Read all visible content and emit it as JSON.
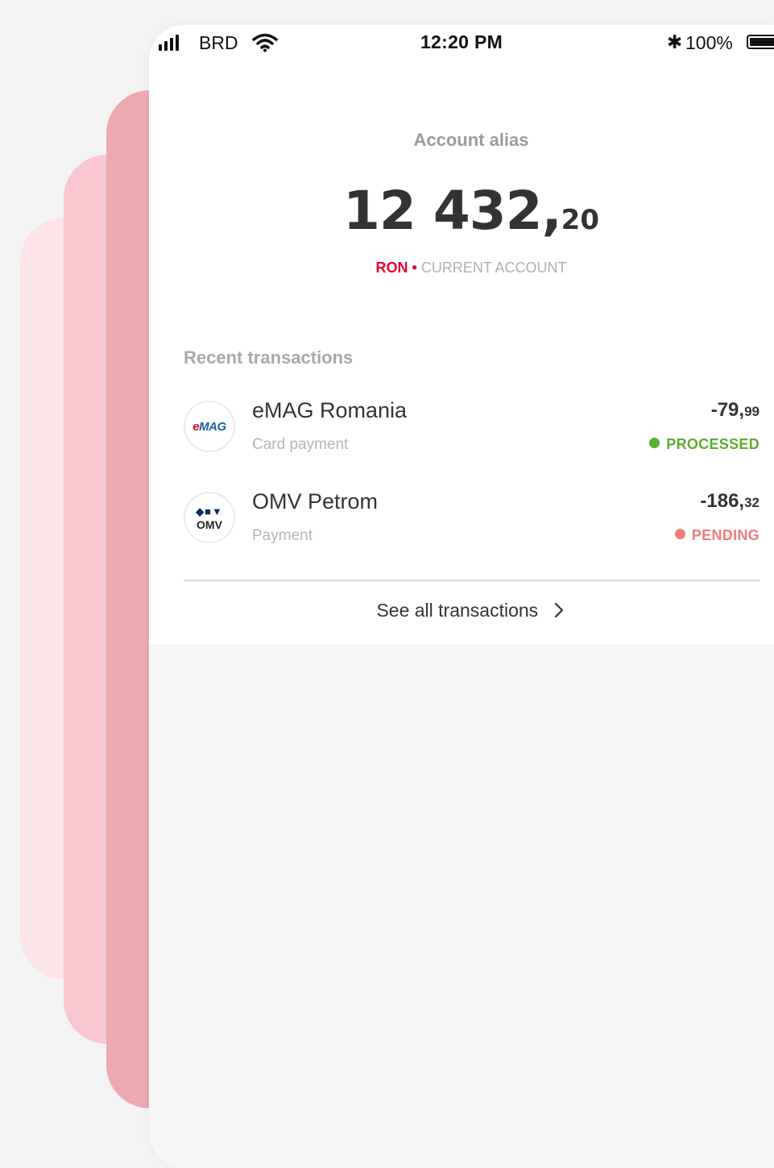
{
  "status_bar": {
    "carrier": "BRD",
    "time": "12:20 PM",
    "battery": "100%",
    "icons": [
      "signal-icon",
      "wifi-icon",
      "bluetooth-icon",
      "battery-icon"
    ]
  },
  "account": {
    "alias": "Account alias",
    "balance_int": "12 432,",
    "balance_dec": "20",
    "currency": "RON",
    "separator": "•",
    "type": "CURRENT ACCOUNT"
  },
  "transactions": {
    "title": "Recent transactions",
    "items": [
      {
        "merchant": "eMAG Romania",
        "type": "Card payment",
        "amount_int": "-79,",
        "amount_dec": "99",
        "status": "PROCESSED",
        "logo_text": "eMAG"
      },
      {
        "merchant": "OMV Petrom",
        "type": "Payment",
        "amount_int": "-186,",
        "amount_dec": "32",
        "status": "PENDING",
        "logo_top": "◆■▼",
        "logo_text": "OMV"
      }
    ],
    "see_all": "See all transactions"
  },
  "colors": {
    "brand_red": "#e4002b",
    "processed": "#5cae2d",
    "pending": "#f07c7c",
    "layer_light": "#fbe3e7",
    "layer_mid": "#f8c7cf",
    "layer_dark": "#eda8b0"
  }
}
